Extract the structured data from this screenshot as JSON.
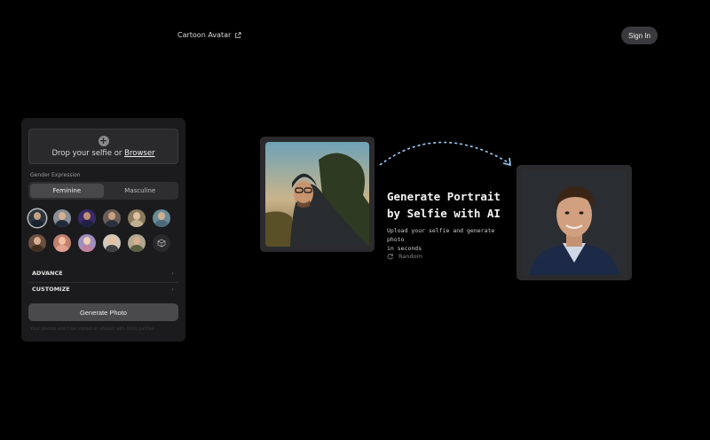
{
  "header": {
    "nav_link": "Cartoon Avatar",
    "sign_in": "Sign In"
  },
  "panel": {
    "drop_prefix": "Drop your selfie or",
    "drop_link": "Browser",
    "gender_label": "Gender Expression",
    "tabs": [
      "Feminine",
      "Masculine"
    ],
    "selected_tab": "Feminine",
    "advance_label": "ADVANCE",
    "customize_label": "CUSTOMIZE",
    "generate_label": "Generate Photo",
    "privacy_note": "Your photos won't be stored or shared with third parties"
  },
  "hero": {
    "headline_line1": "Generate Portrait",
    "headline_line2": "by Selfie with AI",
    "sub_line1": "Upload your selfie and generate photo",
    "sub_line2": "in seconds",
    "random_label": "Random"
  },
  "icons": [
    "external-link-icon",
    "plus-icon",
    "chevron-left-icon",
    "cube-icon",
    "refresh-icon",
    "dashed-arrow-icon"
  ],
  "colors": {
    "background": "#000000",
    "panel": "#1b1b1d",
    "button": "#4a4a4c",
    "arrow": "#9ad0ff"
  }
}
